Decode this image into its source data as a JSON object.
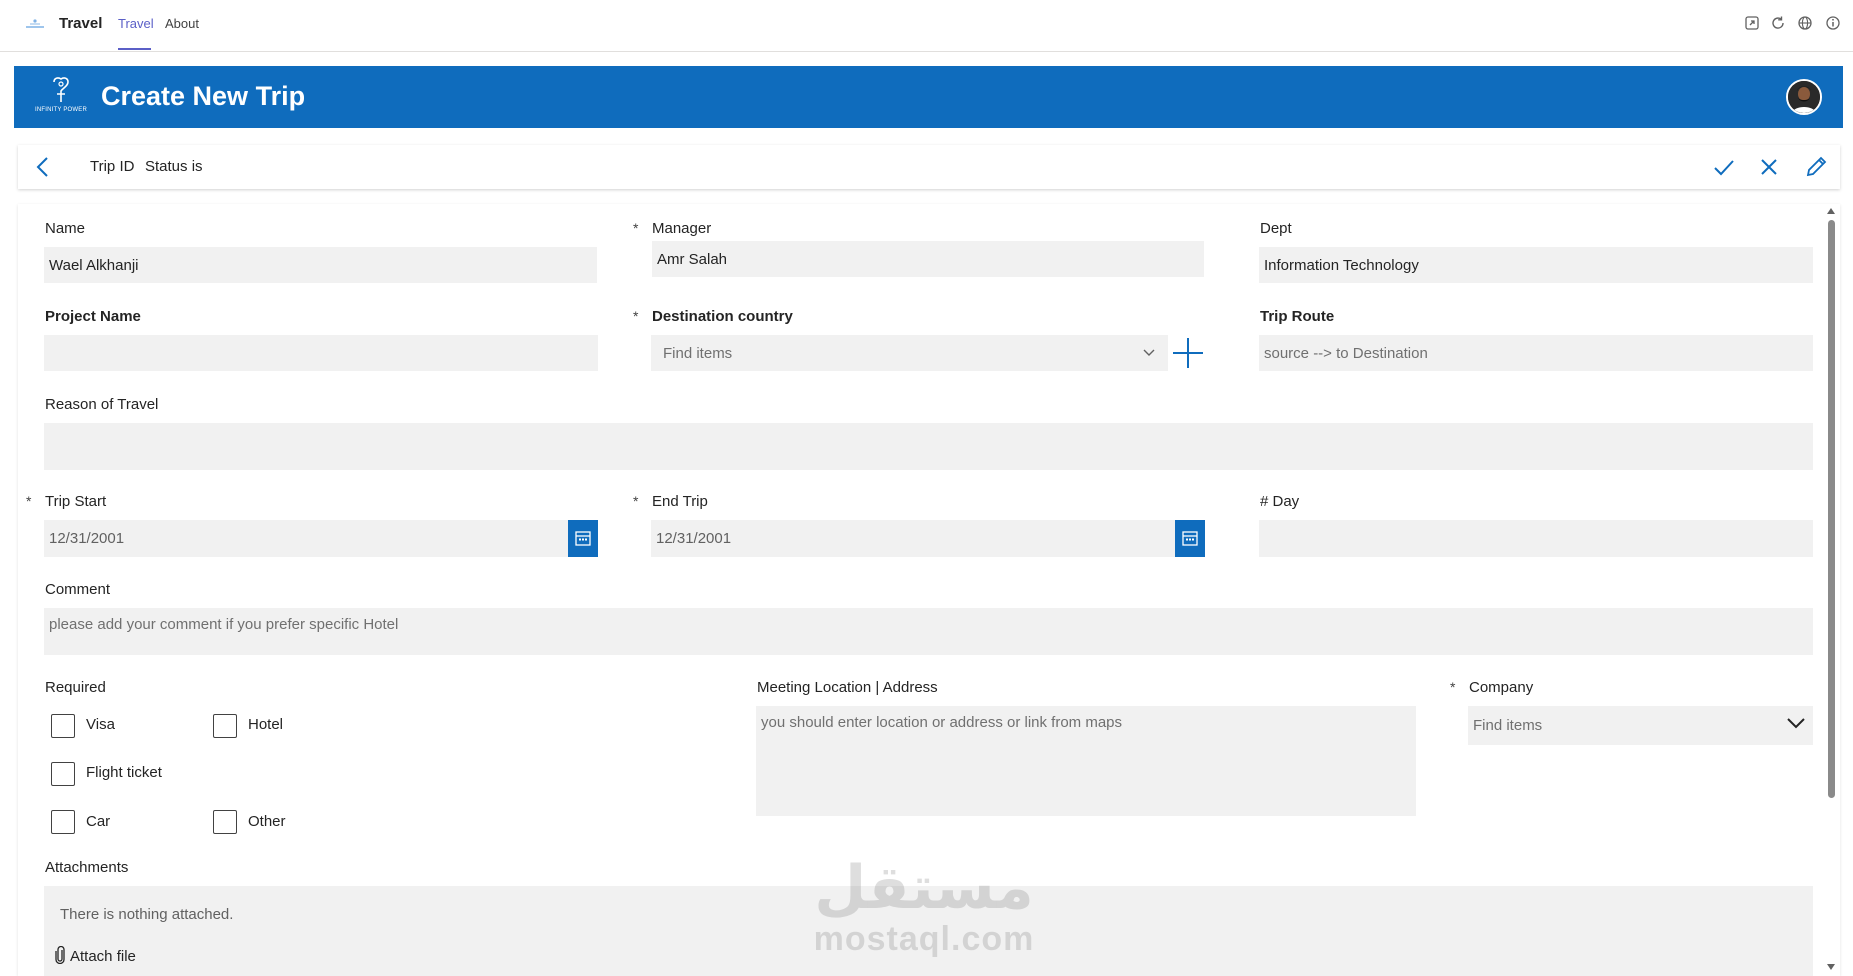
{
  "topbar": {
    "app_name": "Travel",
    "tabs": [
      {
        "label": "Travel",
        "active": true
      },
      {
        "label": "About",
        "active": false
      }
    ],
    "icons": [
      "popout-icon",
      "refresh-icon",
      "globe-icon",
      "info-icon"
    ]
  },
  "banner": {
    "title": "Create New Trip",
    "brand_caption": "INFINITY POWER",
    "color": "#0f6cbd"
  },
  "command_bar": {
    "trip_id_label": "Trip ID",
    "status_label": "Status is",
    "actions": [
      "submit-check-icon",
      "cancel-x-icon",
      "edit-pencil-icon"
    ]
  },
  "form": {
    "name": {
      "label": "Name",
      "value": "Wael Alkhanji",
      "required": false
    },
    "manager": {
      "label": "Manager",
      "value": "Amr Salah",
      "required": true
    },
    "dept": {
      "label": "Dept",
      "value": "Information Technology",
      "required": false
    },
    "project_name": {
      "label": "Project Name",
      "value": "",
      "required": false
    },
    "destination_country": {
      "label": "Destination country",
      "placeholder": "Find items",
      "required": true
    },
    "trip_route": {
      "label": "Trip Route",
      "placeholder": "source --> to Destination",
      "required": false
    },
    "reason_of_travel": {
      "label": "Reason of Travel",
      "value": ""
    },
    "trip_start": {
      "label": "Trip Start",
      "value": "12/31/2001",
      "required": true
    },
    "end_trip": {
      "label": "End Trip",
      "value": "12/31/2001",
      "required": true
    },
    "days": {
      "label": "# Day",
      "value": ""
    },
    "comment": {
      "label": "Comment",
      "placeholder": "please add your comment if you prefer specific Hotel"
    },
    "required_items": {
      "label": "Required",
      "options": [
        {
          "label": "Visa",
          "checked": false
        },
        {
          "label": "Hotel",
          "checked": false
        },
        {
          "label": "Flight ticket",
          "checked": false
        },
        {
          "label": "Car",
          "checked": false
        },
        {
          "label": "Other",
          "checked": false
        }
      ]
    },
    "meeting_location": {
      "label": "Meeting Location | Address",
      "placeholder": "you should enter location or address or link from maps"
    },
    "company": {
      "label": "Company",
      "placeholder": "Find items",
      "required": true
    },
    "attachments": {
      "label": "Attachments",
      "empty_text": "There is nothing attached.",
      "attach_label": "Attach file"
    },
    "required_marker": "*"
  },
  "watermark": {
    "arabic": "مستقل",
    "latin": "mostaql.com"
  }
}
